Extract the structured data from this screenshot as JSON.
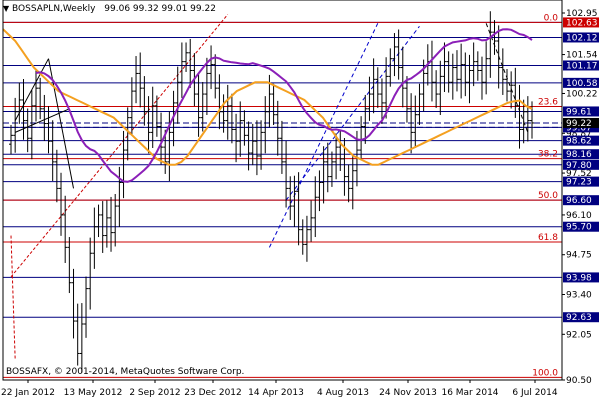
{
  "header": {
    "symbol": "BOSSAPLN,Weekly",
    "ohlc": "99.06 99.32 99.01 99.22"
  },
  "footer": {
    "copyright": "BOSSAFX, © 2001-2014, MetaQuotes Software Corp."
  },
  "colors": {
    "bars": "#000000",
    "ma_fast": "#f4a020",
    "ma_slow": "#8b1fb8",
    "fib": "#cc0000",
    "support": "#000080",
    "trend": "#0000cc",
    "axis_badge": "#000080",
    "badge_text": "#ffffff",
    "last_price_badge": "#000000",
    "top_badge": "#cc0000"
  },
  "chart_data": {
    "type": "candlestick",
    "title": "BOSSAPLN,Weekly",
    "timeframe": "Weekly",
    "ylim": [
      90.5,
      102.95
    ],
    "y_ticks": [
      102.95,
      101.54,
      100.22,
      98.87,
      97.52,
      96.1,
      94.75,
      93.4,
      92.05,
      90.5
    ],
    "x_ticks": [
      "22 Jan 2012",
      "13 May 2012",
      "2 Sep 2012",
      "23 Dec 2012",
      "14 Apr 2013",
      "4 Aug 2013",
      "24 Nov 2013",
      "16 Mar 2014",
      "6 Jul 2014"
    ],
    "last_close": 99.22,
    "horizontal_levels": [
      102.63,
      102.12,
      101.17,
      100.58,
      99.61,
      99.07,
      98.62,
      98.16,
      97.8,
      97.23,
      96.6,
      95.7,
      93.98,
      92.63
    ],
    "highlight_levels": [
      99.22,
      99.07,
      96.6,
      102.63
    ],
    "fibonacci": [
      {
        "label": "0.0",
        "value": 102.63
      },
      {
        "label": "23.6",
        "value": 99.78
      },
      {
        "label": "38.2",
        "value": 98.01
      },
      {
        "label": "50.0",
        "value": 96.6
      },
      {
        "label": "61.8",
        "value": 95.18
      },
      {
        "label": "100.0",
        "value": 90.59
      }
    ],
    "close_series": [
      98.8,
      99.6,
      100.0,
      99.3,
      98.7,
      99.8,
      100.4,
      99.7,
      99.2,
      98.6,
      97.9,
      97.0,
      96.1,
      95.0,
      93.8,
      92.5,
      91.4,
      92.4,
      93.6,
      94.8,
      95.7,
      96.1,
      95.4,
      96.0,
      95.5,
      96.4,
      97.2,
      98.3,
      99.4,
      100.3,
      100.9,
      100.4,
      99.6,
      98.9,
      99.8,
      99.1,
      98.4,
      97.9,
      98.9,
      99.9,
      100.6,
      101.3,
      101.6,
      101.0,
      100.2,
      99.4,
      100.2,
      100.9,
      101.2,
      100.4,
      99.6,
      99.3,
      99.8,
      99.0,
      98.6,
      99.3,
      98.8,
      98.2,
      98.6,
      98.1,
      98.9,
      99.6,
      100.2,
      99.5,
      98.7,
      97.9,
      97.0,
      96.4,
      96.9,
      95.6,
      95.1,
      95.6,
      96.0,
      96.7,
      97.2,
      97.9,
      97.4,
      97.9,
      98.4,
      98.0,
      97.4,
      97.0,
      97.6,
      98.3,
      99.1,
      99.7,
      100.2,
      100.7,
      100.2,
      99.9,
      100.8,
      101.4,
      101.8,
      101.1,
      100.4,
      99.7,
      98.9,
      99.5,
      100.2,
      100.9,
      101.3,
      100.6,
      100.2,
      100.8,
      101.3,
      100.6,
      101.1,
      100.7,
      101.2,
      100.6,
      101.0,
      101.3,
      101.0,
      100.6,
      101.4,
      102.3,
      102.0,
      101.1,
      100.7,
      100.3,
      100.5,
      99.8,
      99.0,
      99.6,
      99.3,
      99.22
    ],
    "ma_fast_series": [
      102.4,
      102.2,
      102.0,
      101.7,
      101.4,
      101.1,
      100.9,
      100.7,
      100.5,
      100.3,
      100.2,
      100.1,
      100.0,
      99.9,
      99.8,
      99.7,
      99.6,
      99.5,
      99.4,
      99.2,
      99.0,
      98.8,
      98.6,
      98.4,
      98.2,
      98.0,
      97.9,
      97.8,
      97.8,
      97.9,
      98.1,
      98.4,
      98.7,
      99.0,
      99.3,
      99.6,
      99.9,
      100.1,
      100.3,
      100.4,
      100.5,
      100.6,
      100.6,
      100.6,
      100.5,
      100.4,
      100.3,
      100.2,
      100.1,
      100.0,
      99.8,
      99.6,
      99.4,
      99.1,
      98.8,
      98.5,
      98.3,
      98.1,
      98.0,
      97.9,
      97.8,
      97.8,
      97.9,
      98.0,
      98.1,
      98.2,
      98.3,
      98.4,
      98.5,
      98.6,
      98.7,
      98.8,
      98.9,
      99.0,
      99.1,
      99.2,
      99.3,
      99.4,
      99.5,
      99.6,
      99.7,
      99.8,
      99.9,
      99.95,
      99.98,
      99.8,
      99.7
    ]
  }
}
